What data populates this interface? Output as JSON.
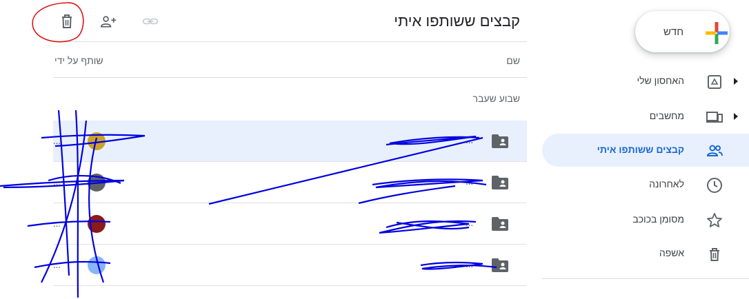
{
  "sidebar": {
    "new_label": "חדש",
    "items": [
      {
        "label": "האחסון שלי",
        "icon": "drive-icon",
        "has_caret": true,
        "active": false
      },
      {
        "label": "מחשבים",
        "icon": "computers-icon",
        "has_caret": true,
        "active": false
      },
      {
        "label": "קבצים ששותפו איתי",
        "icon": "shared-people-icon",
        "has_caret": false,
        "active": true
      },
      {
        "label": "לאחרונה",
        "icon": "clock-icon",
        "has_caret": false,
        "active": false
      },
      {
        "label": "מסומן בכוכב",
        "icon": "star-icon",
        "has_caret": false,
        "active": false
      },
      {
        "label": "אשפה",
        "icon": "trash-icon",
        "has_caret": false,
        "active": false
      }
    ]
  },
  "main": {
    "title": "קבצים ששותפו איתי",
    "toolbar": {
      "icons": [
        "trash-icon",
        "add-person-icon",
        "link-icon"
      ]
    },
    "columns": {
      "name": "שם",
      "shared_by": "שותף על ידי"
    },
    "group_label": "שבוע שעבר",
    "rows": [
      {
        "name": "...",
        "owner": "...",
        "icon": "shared-folder-icon",
        "avatar_color": "#c9a227",
        "selected": true
      },
      {
        "name": "...",
        "owner": "...",
        "icon": "shared-folder-icon",
        "avatar_color": "#5f6368",
        "selected": false
      },
      {
        "name": "...",
        "owner": "...",
        "icon": "shared-folder-icon",
        "avatar_color": "#8b1a1a",
        "selected": false
      },
      {
        "name": "...",
        "owner": "...",
        "icon": "shared-folder-icon",
        "avatar_color": "#8ab4f8",
        "selected": false
      }
    ]
  },
  "colors": {
    "accent": "#1967d2",
    "active_bg": "#e8f0fe",
    "annotation_red": "#e01010",
    "scribble_blue": "#0000e0"
  }
}
